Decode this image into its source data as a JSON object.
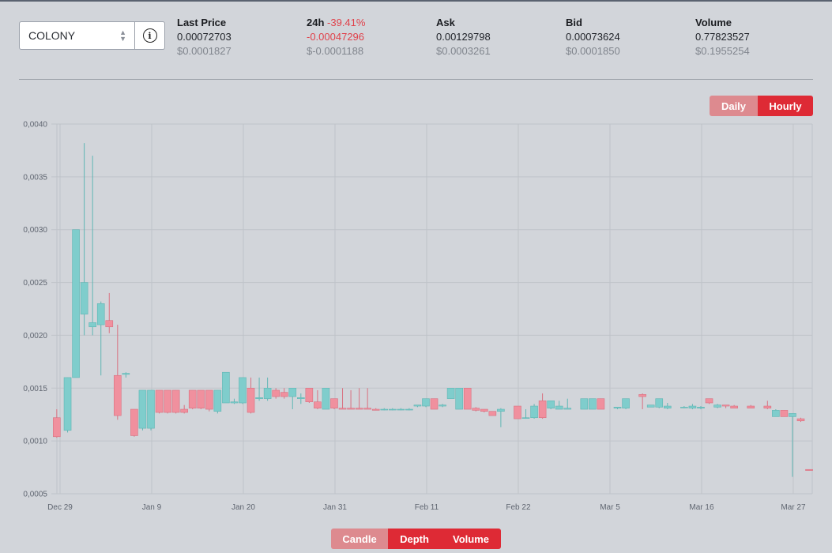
{
  "market": {
    "selected": "COLONY"
  },
  "stats": {
    "last_price": {
      "label": "Last Price",
      "value": "0.00072703",
      "usd": "$0.0001827"
    },
    "change_24h": {
      "label": "24h",
      "pct": "-39.41%",
      "value": "-0.00047296",
      "usd": "$-0.0001188"
    },
    "ask": {
      "label": "Ask",
      "value": "0.00129798",
      "usd": "$0.0003261"
    },
    "bid": {
      "label": "Bid",
      "value": "0.00073624",
      "usd": "$0.0001850"
    },
    "volume": {
      "label": "Volume",
      "value": "0.77823527",
      "usd": "$0.1955254"
    }
  },
  "interval_toggle": {
    "daily": "Daily",
    "hourly": "Hourly",
    "active": "Hourly"
  },
  "view_toggle": {
    "candle": "Candle",
    "depth": "Depth",
    "volume": "Volume",
    "active": "Depth"
  },
  "colors": {
    "up": "#7fcdcc",
    "up_stroke": "#5fb6b4",
    "down": "#f0909e",
    "down_stroke": "#d97080",
    "grid": "#bfc3c9",
    "accent": "#de2a35"
  },
  "chart_data": {
    "type": "candlestick",
    "ylim": [
      0.0005,
      0.004
    ],
    "yticks": [
      "0,0040",
      "0,0035",
      "0,0030",
      "0,0025",
      "0,0020",
      "0,0015",
      "0,0010",
      "0,0005"
    ],
    "ytick_values": [
      0.004,
      0.0035,
      0.003,
      0.0025,
      0.002,
      0.0015,
      0.001,
      0.0005
    ],
    "xticks": [
      "Dec 29",
      "Jan 9",
      "Jan 20",
      "Jan 31",
      "Feb 11",
      "Feb 22",
      "Mar 5",
      "Mar 16",
      "Mar 27"
    ],
    "xtick_days": [
      0,
      11,
      22,
      33,
      44,
      55,
      66,
      77,
      88
    ],
    "candles": [
      {
        "d": -0.3,
        "o": 0.00122,
        "h": 0.0013,
        "l": 0.00103,
        "c": 0.00104
      },
      {
        "d": 1.0,
        "o": 0.0011,
        "h": 0.0016,
        "l": 0.00108,
        "c": 0.0016
      },
      {
        "d": 2.0,
        "o": 0.0016,
        "h": 0.003,
        "l": 0.0016,
        "c": 0.003
      },
      {
        "d": 3.0,
        "o": 0.0022,
        "h": 0.00382,
        "l": 0.002,
        "c": 0.0025
      },
      {
        "d": 4.0,
        "o": 0.00208,
        "h": 0.0037,
        "l": 0.002,
        "c": 0.00212
      },
      {
        "d": 5.0,
        "o": 0.0021,
        "h": 0.00232,
        "l": 0.00162,
        "c": 0.0023
      },
      {
        "d": 6.0,
        "o": 0.00214,
        "h": 0.0024,
        "l": 0.00202,
        "c": 0.00208
      },
      {
        "d": 7.0,
        "o": 0.00162,
        "h": 0.0021,
        "l": 0.0012,
        "c": 0.00124
      },
      {
        "d": 8.0,
        "o": 0.00163,
        "h": 0.00165,
        "l": 0.0016,
        "c": 0.00164
      },
      {
        "d": 9.0,
        "o": 0.0013,
        "h": 0.0013,
        "l": 0.00104,
        "c": 0.00105
      },
      {
        "d": 10.0,
        "o": 0.00112,
        "h": 0.00148,
        "l": 0.0011,
        "c": 0.00148
      },
      {
        "d": 11.0,
        "o": 0.00112,
        "h": 0.00148,
        "l": 0.0011,
        "c": 0.00148
      },
      {
        "d": 12.0,
        "o": 0.00148,
        "h": 0.00148,
        "l": 0.00126,
        "c": 0.00127
      },
      {
        "d": 13.0,
        "o": 0.00148,
        "h": 0.00148,
        "l": 0.00126,
        "c": 0.00127
      },
      {
        "d": 14.0,
        "o": 0.00148,
        "h": 0.00148,
        "l": 0.00126,
        "c": 0.00127
      },
      {
        "d": 15.0,
        "o": 0.0013,
        "h": 0.00134,
        "l": 0.00126,
        "c": 0.00127
      },
      {
        "d": 16.0,
        "o": 0.00148,
        "h": 0.00148,
        "l": 0.0013,
        "c": 0.00131
      },
      {
        "d": 17.0,
        "o": 0.00148,
        "h": 0.00148,
        "l": 0.0013,
        "c": 0.00131
      },
      {
        "d": 18.0,
        "o": 0.00148,
        "h": 0.00148,
        "l": 0.00128,
        "c": 0.0013
      },
      {
        "d": 19.0,
        "o": 0.00128,
        "h": 0.00148,
        "l": 0.00126,
        "c": 0.00148
      },
      {
        "d": 20.0,
        "o": 0.00136,
        "h": 0.00165,
        "l": 0.00136,
        "c": 0.00165
      },
      {
        "d": 21.0,
        "o": 0.00136,
        "h": 0.0014,
        "l": 0.00135,
        "c": 0.00137
      },
      {
        "d": 22.0,
        "o": 0.00136,
        "h": 0.0016,
        "l": 0.00135,
        "c": 0.0016
      },
      {
        "d": 23.0,
        "o": 0.0015,
        "h": 0.0016,
        "l": 0.00126,
        "c": 0.00127
      },
      {
        "d": 24.0,
        "o": 0.0014,
        "h": 0.0016,
        "l": 0.00138,
        "c": 0.00141
      },
      {
        "d": 25.0,
        "o": 0.0014,
        "h": 0.0016,
        "l": 0.00138,
        "c": 0.0015
      },
      {
        "d": 26.0,
        "o": 0.00148,
        "h": 0.0015,
        "l": 0.0014,
        "c": 0.00142
      },
      {
        "d": 27.0,
        "o": 0.00146,
        "h": 0.0015,
        "l": 0.0014,
        "c": 0.00142
      },
      {
        "d": 28.0,
        "o": 0.00142,
        "h": 0.0015,
        "l": 0.0013,
        "c": 0.0015
      },
      {
        "d": 29.0,
        "o": 0.0014,
        "h": 0.00145,
        "l": 0.00135,
        "c": 0.00141
      },
      {
        "d": 30.0,
        "o": 0.0015,
        "h": 0.0015,
        "l": 0.00136,
        "c": 0.00137
      },
      {
        "d": 31.0,
        "o": 0.00137,
        "h": 0.00148,
        "l": 0.0013,
        "c": 0.00131
      },
      {
        "d": 32.0,
        "o": 0.0013,
        "h": 0.0015,
        "l": 0.0013,
        "c": 0.0015
      },
      {
        "d": 33.0,
        "o": 0.0014,
        "h": 0.0014,
        "l": 0.0013,
        "c": 0.00131
      },
      {
        "d": 34.0,
        "o": 0.00131,
        "h": 0.0015,
        "l": 0.0013,
        "c": 0.0013
      },
      {
        "d": 35.0,
        "o": 0.00131,
        "h": 0.00148,
        "l": 0.0013,
        "c": 0.0013
      },
      {
        "d": 36.0,
        "o": 0.00131,
        "h": 0.0015,
        "l": 0.0013,
        "c": 0.0013
      },
      {
        "d": 37.0,
        "o": 0.00131,
        "h": 0.0015,
        "l": 0.0013,
        "c": 0.0013
      },
      {
        "d": 38.0,
        "o": 0.0013,
        "h": 0.00131,
        "l": 0.00129,
        "c": 0.00129
      },
      {
        "d": 39.0,
        "o": 0.0013,
        "h": 0.00131,
        "l": 0.00129,
        "c": 0.0013
      },
      {
        "d": 40.0,
        "o": 0.0013,
        "h": 0.00131,
        "l": 0.00129,
        "c": 0.0013
      },
      {
        "d": 41.0,
        "o": 0.0013,
        "h": 0.00131,
        "l": 0.00129,
        "c": 0.0013
      },
      {
        "d": 42.0,
        "o": 0.0013,
        "h": 0.00131,
        "l": 0.00129,
        "c": 0.0013
      },
      {
        "d": 43.0,
        "o": 0.00133,
        "h": 0.00134,
        "l": 0.00132,
        "c": 0.00134
      },
      {
        "d": 44.0,
        "o": 0.00133,
        "h": 0.0014,
        "l": 0.00132,
        "c": 0.0014
      },
      {
        "d": 45.0,
        "o": 0.0014,
        "h": 0.0014,
        "l": 0.0013,
        "c": 0.0013
      },
      {
        "d": 46.0,
        "o": 0.00133,
        "h": 0.00135,
        "l": 0.00132,
        "c": 0.00134
      },
      {
        "d": 47.0,
        "o": 0.0014,
        "h": 0.0015,
        "l": 0.0014,
        "c": 0.0015
      },
      {
        "d": 48.0,
        "o": 0.0013,
        "h": 0.0015,
        "l": 0.0013,
        "c": 0.0015
      },
      {
        "d": 49.0,
        "o": 0.0015,
        "h": 0.0015,
        "l": 0.0013,
        "c": 0.0013
      },
      {
        "d": 50.0,
        "o": 0.00131,
        "h": 0.00132,
        "l": 0.00128,
        "c": 0.00129
      },
      {
        "d": 51.0,
        "o": 0.0013,
        "h": 0.0013,
        "l": 0.00127,
        "c": 0.00128
      },
      {
        "d": 52.0,
        "o": 0.00128,
        "h": 0.00128,
        "l": 0.00124,
        "c": 0.00124
      },
      {
        "d": 53.0,
        "o": 0.00128,
        "h": 0.00131,
        "l": 0.00113,
        "c": 0.0013
      },
      {
        "d": 55.0,
        "o": 0.00133,
        "h": 0.00133,
        "l": 0.00121,
        "c": 0.00121
      },
      {
        "d": 56.0,
        "o": 0.00122,
        "h": 0.0013,
        "l": 0.00121,
        "c": 0.00122
      },
      {
        "d": 57.0,
        "o": 0.00122,
        "h": 0.00135,
        "l": 0.00121,
        "c": 0.00133
      },
      {
        "d": 58.0,
        "o": 0.00138,
        "h": 0.00145,
        "l": 0.00121,
        "c": 0.00122
      },
      {
        "d": 59.0,
        "o": 0.00131,
        "h": 0.00138,
        "l": 0.0013,
        "c": 0.00138
      },
      {
        "d": 60.0,
        "o": 0.0013,
        "h": 0.00138,
        "l": 0.0013,
        "c": 0.00133
      },
      {
        "d": 61.0,
        "o": 0.0013,
        "h": 0.0014,
        "l": 0.0013,
        "c": 0.00131
      },
      {
        "d": 63.0,
        "o": 0.0013,
        "h": 0.0014,
        "l": 0.0013,
        "c": 0.0014
      },
      {
        "d": 64.0,
        "o": 0.0013,
        "h": 0.0014,
        "l": 0.0013,
        "c": 0.0014
      },
      {
        "d": 65.0,
        "o": 0.0014,
        "h": 0.0014,
        "l": 0.0013,
        "c": 0.0013
      },
      {
        "d": 67.0,
        "o": 0.00131,
        "h": 0.00132,
        "l": 0.0013,
        "c": 0.00132
      },
      {
        "d": 68.0,
        "o": 0.00131,
        "h": 0.0014,
        "l": 0.0013,
        "c": 0.0014
      },
      {
        "d": 70.0,
        "o": 0.00144,
        "h": 0.00145,
        "l": 0.0013,
        "c": 0.00142
      },
      {
        "d": 71.0,
        "o": 0.00132,
        "h": 0.00134,
        "l": 0.00132,
        "c": 0.00134
      },
      {
        "d": 72.0,
        "o": 0.00132,
        "h": 0.0014,
        "l": 0.00131,
        "c": 0.0014
      },
      {
        "d": 73.0,
        "o": 0.00131,
        "h": 0.00136,
        "l": 0.0013,
        "c": 0.00133
      },
      {
        "d": 75.0,
        "o": 0.00132,
        "h": 0.00133,
        "l": 0.00131,
        "c": 0.00132
      },
      {
        "d": 76.0,
        "o": 0.00131,
        "h": 0.00135,
        "l": 0.0013,
        "c": 0.00133
      },
      {
        "d": 77.0,
        "o": 0.00131,
        "h": 0.00133,
        "l": 0.0013,
        "c": 0.00132
      },
      {
        "d": 78.0,
        "o": 0.0014,
        "h": 0.0014,
        "l": 0.00135,
        "c": 0.00136
      },
      {
        "d": 79.0,
        "o": 0.00132,
        "h": 0.00135,
        "l": 0.00131,
        "c": 0.00134
      },
      {
        "d": 80.0,
        "o": 0.00134,
        "h": 0.00134,
        "l": 0.00131,
        "c": 0.00133
      },
      {
        "d": 81.0,
        "o": 0.00133,
        "h": 0.00134,
        "l": 0.00131,
        "c": 0.00131
      },
      {
        "d": 83.0,
        "o": 0.00133,
        "h": 0.00134,
        "l": 0.00131,
        "c": 0.00131
      },
      {
        "d": 85.0,
        "o": 0.00133,
        "h": 0.00138,
        "l": 0.0013,
        "c": 0.00131
      },
      {
        "d": 86.0,
        "o": 0.00123,
        "h": 0.0013,
        "l": 0.00123,
        "c": 0.00129
      },
      {
        "d": 87.0,
        "o": 0.00129,
        "h": 0.00129,
        "l": 0.00123,
        "c": 0.00123
      },
      {
        "d": 88.0,
        "o": 0.00123,
        "h": 0.00126,
        "l": 0.00066,
        "c": 0.00126
      },
      {
        "d": 89.0,
        "o": 0.00121,
        "h": 0.00122,
        "l": 0.00118,
        "c": 0.00119
      },
      {
        "d": 90.0,
        "o": 0.00073,
        "h": 0.00073,
        "l": 0.00072,
        "c": 0.00072
      }
    ]
  }
}
